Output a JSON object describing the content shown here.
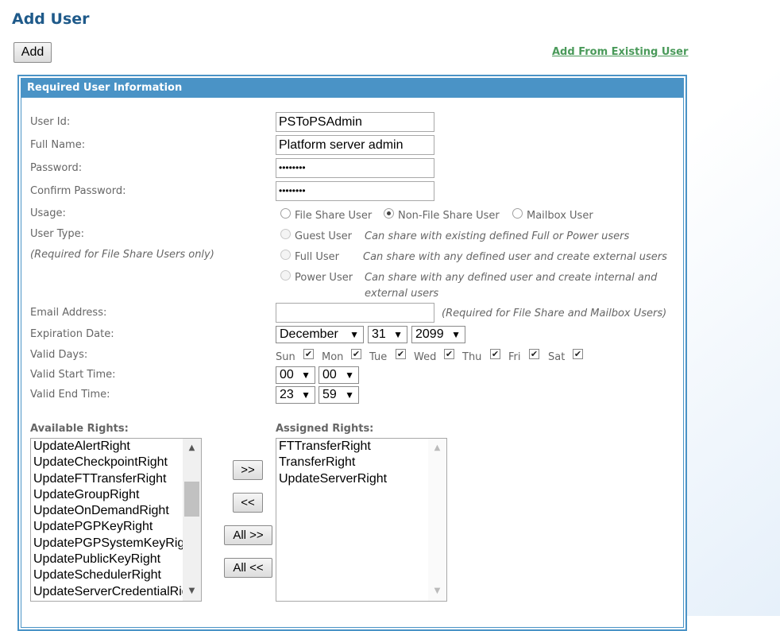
{
  "page": {
    "title": "Add User",
    "add_button": "Add",
    "existing_link": "Add From Existing User"
  },
  "panel": {
    "header": "Required User Information"
  },
  "fields": {
    "user_id": {
      "label": "User Id:",
      "value": "PSToPSAdmin"
    },
    "full_name": {
      "label": "Full Name:",
      "value": "Platform server admin"
    },
    "password": {
      "label": "Password:",
      "value": "••••••••"
    },
    "confirm_password": {
      "label": "Confirm Password:",
      "value": "••••••••"
    },
    "email": {
      "label": "Email Address:",
      "value": "",
      "note": "(Required for File Share and Mailbox Users)"
    }
  },
  "usage": {
    "label": "Usage:",
    "options": [
      "File Share User",
      "Non-File Share User",
      "Mailbox User"
    ],
    "selected": "Non-File Share User"
  },
  "user_type": {
    "label": "User Type:",
    "note": "(Required for File Share Users only)",
    "options": [
      {
        "label": "Guest User",
        "desc": "Can share with existing defined Full or Power users"
      },
      {
        "label": "Full User",
        "desc": "Can share with any defined user and create external users"
      },
      {
        "label": "Power User",
        "desc": "Can share with any defined user and create internal and",
        "desc2": "external users"
      }
    ]
  },
  "expiration": {
    "label": "Expiration Date:",
    "month": "December",
    "day": "31",
    "year": "2099"
  },
  "valid_days": {
    "label": "Valid Days:",
    "days": [
      "Sun",
      "Mon",
      "Tue",
      "Wed",
      "Thu",
      "Fri",
      "Sat"
    ],
    "check": "✔"
  },
  "start_time": {
    "label": "Valid Start Time:",
    "hour": "00",
    "minute": "00"
  },
  "end_time": {
    "label": "Valid End Time:",
    "hour": "23",
    "minute": "59"
  },
  "rights": {
    "available_label": "Available Rights:",
    "assigned_label": "Assigned Rights:",
    "available": [
      "UpdateAlertRight",
      "UpdateCheckpointRight",
      "UpdateFTTransferRight",
      "UpdateGroupRight",
      "UpdateOnDemandRight",
      "UpdatePGPKeyRight",
      "UpdatePGPSystemKeyRight",
      "UpdatePublicKeyRight",
      "UpdateSchedulerRight",
      "UpdateServerCredentialRight"
    ],
    "assigned": [
      "FTTransferRight",
      "TransferRight",
      "UpdateServerRight"
    ],
    "move_right": ">>",
    "move_left": "<<",
    "all_right": "All >>",
    "all_left": "All <<"
  },
  "icons": {
    "dropdown": "▼",
    "up": "▲",
    "down": "▼"
  }
}
